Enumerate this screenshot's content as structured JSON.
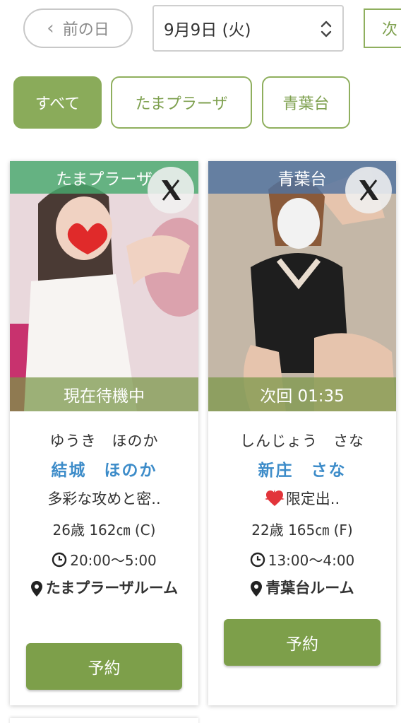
{
  "nav": {
    "prev_label": "前の日",
    "date_value": "9月9日 (火)",
    "next_label": "次"
  },
  "filters": [
    {
      "label": "すべて",
      "active": true
    },
    {
      "label": "たまプラーザ",
      "active": false
    },
    {
      "label": "青葉台",
      "active": false
    }
  ],
  "cards": [
    {
      "area": "たまプラーザ",
      "status": "現在待機中",
      "name_kana": "ゆうき　ほのか",
      "name": "結城　ほのか",
      "catchcopy": "多彩な攻めと密..",
      "specs": "26歳 162㎝ (C)",
      "hours": "20:00〜5:00",
      "room": "たまプラーザルーム",
      "reserve_label": "予約"
    },
    {
      "area": "青葉台",
      "status": "次回 01:35",
      "name_kana": "しんじょう　さな",
      "name": "新庄　さな",
      "catchcopy": "限定出..",
      "specs": "22歳 165㎝ (F)",
      "hours": "13:00〜4:00",
      "room": "青葉台ルーム",
      "reserve_label": "予約"
    }
  ],
  "colors": {
    "accent_green": "#8aab5a",
    "name_blue": "#3d8cc9",
    "area_green": "#48aa6e",
    "area_blue": "#5073a0"
  }
}
